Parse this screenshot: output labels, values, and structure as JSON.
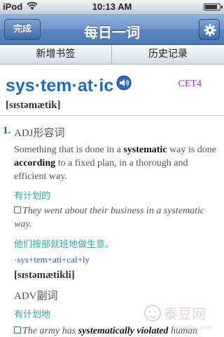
{
  "status_bar": {
    "carrier": "iPod",
    "time": "10:13 AM",
    "battery_level": 0.9
  },
  "nav": {
    "done_label": "完成",
    "title": "每日一词"
  },
  "tabs": {
    "add_bookmark": "新增书签",
    "history": "历史记录"
  },
  "entry": {
    "headword": "sys·tem·at·ic",
    "level": "CET4",
    "phonetic": "[sɪstəmætik]",
    "sense_number": "1.",
    "pos_abbr": "ADJ",
    "pos_cn": "形容词",
    "definition": {
      "part1": "Something that is done in a ",
      "bold1": "systematic",
      "part2": " way is done ",
      "bold2": "according",
      "part3": " to a fixed plan, in a thorough and efficient way."
    },
    "meaning_cn": "有计划的",
    "example1": "They went about their business in a systematic way.",
    "example1_cn": "他们按部就班地做生意。",
    "morphology": "·sys+tem+ati+cal+ly",
    "phonetic2": "[sɪstəmætikli]",
    "pos2_abbr": "ADV",
    "pos2_cn": "副词",
    "meaning2_cn": "有计划地",
    "example2": {
      "part1": "The army has ",
      "bold1": "systematically",
      "part2": " ",
      "bold2": "violated",
      "part3": " human"
    }
  },
  "watermark_text": "泰豆网",
  "watermark_url": "ifsoudou.com",
  "colors": {
    "nav_blue": "#5985c1",
    "headword_blue": "#1e6cc2",
    "level_purple": "#9933cc",
    "chinese_teal": "#2eaaaa"
  },
  "icons": {
    "wifi": "wifi-icon",
    "battery": "battery-icon",
    "gear": "gear-icon",
    "speaker": "speaker-icon",
    "bullet": "example-bullet-icon"
  }
}
